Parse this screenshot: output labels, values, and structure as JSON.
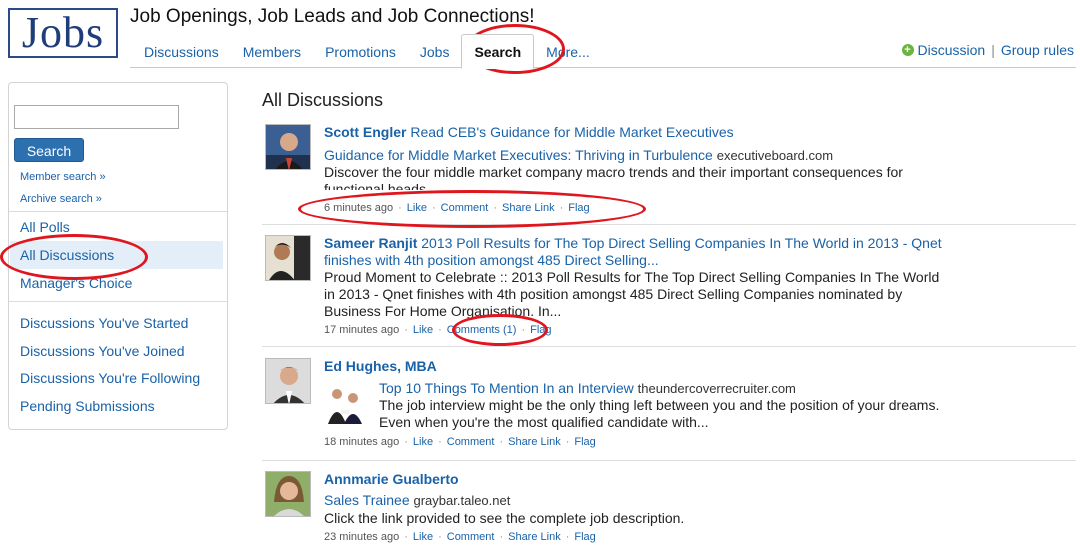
{
  "header": {
    "logo_text": "Jobs",
    "group_title": "Job Openings, Job Leads and Job Connections!",
    "tabs": [
      {
        "label": "Discussions"
      },
      {
        "label": "Members"
      },
      {
        "label": "Promotions"
      },
      {
        "label": "Jobs"
      },
      {
        "label": "Search",
        "active": true
      },
      {
        "label": "More..."
      }
    ],
    "discussion_link": "Discussion",
    "separator": "|",
    "group_rules_link": "Group rules"
  },
  "sidebar": {
    "search_input_value": "",
    "search_button": "Search",
    "member_search": "Member search »",
    "archive_search": "Archive search »",
    "items": [
      {
        "label": "All Polls"
      },
      {
        "label": "All Discussions",
        "active": true
      },
      {
        "label": "Manager's Choice"
      },
      {
        "label": "Discussions You've Started"
      },
      {
        "label": "Discussions You've Joined"
      },
      {
        "label": "Discussions You're Following"
      },
      {
        "label": "Pending Submissions"
      }
    ]
  },
  "main": {
    "title": "All Discussions",
    "posts": [
      {
        "author": "Scott Engler",
        "title": "Read CEB's Guidance for Middle Market Executives",
        "link_title": "Guidance for Middle Market Executives: Thriving in Turbulence",
        "link_domain": "executiveboard.com",
        "snippet": "Discover the four middle market company macro trends and their important consequences for functional heads.",
        "time": "6 minutes ago",
        "actions": [
          "Like",
          "Comment",
          "Share Link",
          "Flag"
        ]
      },
      {
        "author": "Sameer Ranjit",
        "title_line1": "2013 Poll Results for The Top Direct Selling Companies In The World in 2013 - Qnet",
        "title_line2": "finishes with 4th position amongst 485 Direct Selling...",
        "snippet_line1": "Proud Moment to Celebrate :: 2013 Poll Results for The Top Direct Selling Companies In The World",
        "snippet_line2": "in 2013 - Qnet finishes with 4th position amongst 485 Direct Selling Companies nominated by",
        "snippet_line3": "Business For Home Organisation. In...",
        "time": "17 minutes ago",
        "actions": [
          "Like",
          "Comments (1)",
          "Flag"
        ]
      },
      {
        "author": "Ed Hughes, MBA",
        "link_title": "Top 10 Things To Mention In an Interview",
        "link_domain": "theundercoverrecruiter.com",
        "snippet_line1": "The job interview might be the only thing left between you and the position of your dreams.",
        "snippet_line2": "Even when you're the most qualified candidate with...",
        "time": "18 minutes ago",
        "actions": [
          "Like",
          "Comment",
          "Share Link",
          "Flag"
        ]
      },
      {
        "author": "Annmarie Gualberto",
        "link_title": "Sales Trainee",
        "link_domain": "graybar.taleo.net",
        "snippet": "Click the link provided to see the complete job description.",
        "time": "23 minutes ago",
        "actions": [
          "Like",
          "Comment",
          "Share Link",
          "Flag"
        ]
      }
    ]
  },
  "colors": {
    "link_blue": "#1a62a8",
    "button_blue": "#2c70b0",
    "annotation_red": "#e0161e",
    "active_bg": "#e3eef9",
    "plus_green": "#6cb33f"
  }
}
